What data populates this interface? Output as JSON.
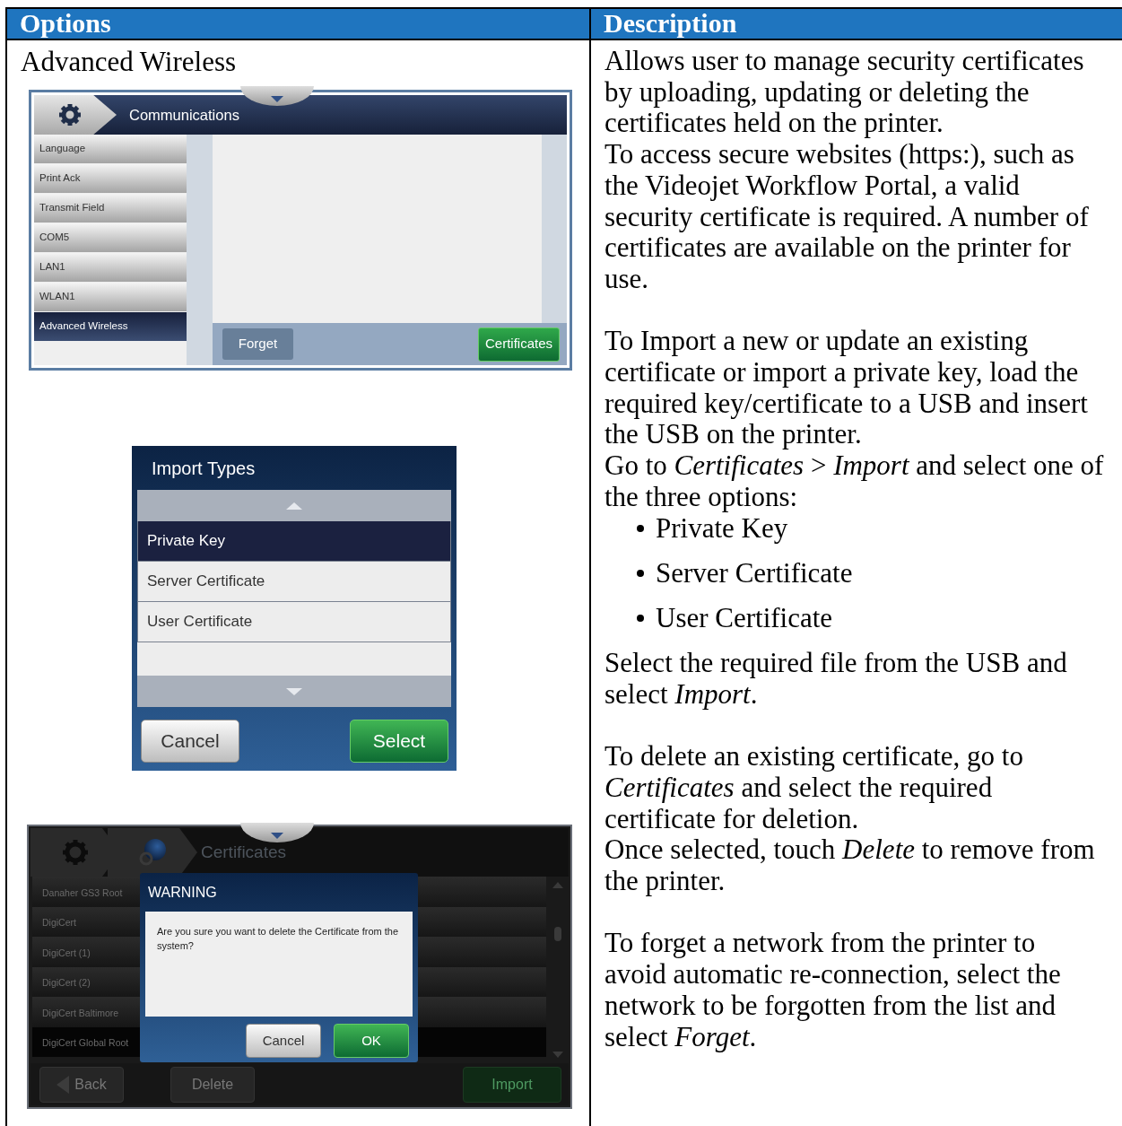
{
  "table": {
    "columns": [
      "Options",
      "Description"
    ]
  },
  "option": {
    "title": "Advanced Wireless"
  },
  "communications_screen": {
    "title": "Communications",
    "menu": [
      {
        "label": "Language",
        "selected": false
      },
      {
        "label": "Print Ack",
        "selected": false
      },
      {
        "label": "Transmit Field",
        "selected": false
      },
      {
        "label": "COM5",
        "selected": false
      },
      {
        "label": "LAN1",
        "selected": false
      },
      {
        "label": "WLAN1",
        "selected": false
      },
      {
        "label": "Advanced Wireless",
        "selected": true
      }
    ],
    "buttons": [
      {
        "label": "Forget",
        "kind": "secondary"
      },
      {
        "label": "Certificates",
        "kind": "primary"
      }
    ]
  },
  "import_types_dialog": {
    "title": "Import Types",
    "options": [
      {
        "label": "Private Key",
        "selected": true
      },
      {
        "label": "Server Certificate",
        "selected": false
      },
      {
        "label": "User Certificate",
        "selected": false
      }
    ],
    "buttons": [
      {
        "label": "Cancel",
        "kind": "secondary"
      },
      {
        "label": "Select",
        "kind": "primary"
      }
    ]
  },
  "certificates_screen": {
    "title": "Certificates",
    "items": [
      {
        "label": "Danaher GS3 Root",
        "selected": false
      },
      {
        "label": "DigiCert",
        "selected": false
      },
      {
        "label": "DigiCert (1)",
        "selected": false
      },
      {
        "label": "DigiCert (2)",
        "selected": false
      },
      {
        "label": "DigiCert Baltimore",
        "selected": false
      },
      {
        "label": "DigiCert Global Root",
        "selected": true
      }
    ],
    "buttons": [
      {
        "label": "Back",
        "kind": "back"
      },
      {
        "label": "Delete",
        "kind": "secondary"
      },
      {
        "label": "Import",
        "kind": "primary"
      }
    ],
    "dialog": {
      "title": "WARNING",
      "message": "Are you sure you want to delete the Certificate from the system?",
      "buttons": [
        {
          "label": "Cancel",
          "kind": "secondary"
        },
        {
          "label": "OK",
          "kind": "primary"
        }
      ]
    }
  },
  "description": [
    {
      "blocks": [
        {
          "kind": "para",
          "lines": [
            "Allows user to manage security certificates",
            "by uploading, updating or deleting the",
            "certificates held on the printer."
          ]
        },
        {
          "kind": "para",
          "lines": [
            "To access secure websites (https:), such as",
            "the Videojet Workflow Portal, a valid",
            "security certificate is required. A number of",
            "certificates are available on the printer for",
            "use."
          ]
        }
      ]
    },
    {
      "blocks": [
        {
          "kind": "para",
          "lines": [
            "To Import a new or update an existing",
            "certificate or import a private key, load the",
            "required key/certificate to a USB and insert",
            "the USB on the printer."
          ]
        },
        {
          "kind": "para",
          "lines": [
            "Go to *Certificates* > *Import* and select one of",
            "the three options:"
          ]
        },
        {
          "kind": "bullets",
          "items": [
            "Private Key",
            "Server Certificate",
            "User Certificate"
          ]
        },
        {
          "kind": "para",
          "lines": [
            "Select the required file from the USB and",
            "select *Import*."
          ]
        }
      ]
    },
    {
      "blocks": [
        {
          "kind": "para",
          "lines": [
            "To delete an existing certificate, go to",
            "*Certificates* and select the required",
            "certificate for deletion."
          ]
        },
        {
          "kind": "para",
          "lines": [
            "Once selected, touch *Delete* to remove from",
            "the printer."
          ]
        }
      ]
    },
    {
      "blocks": [
        {
          "kind": "para",
          "lines": [
            "To forget a network from the printer to",
            "avoid automatic re-connection, select the",
            "network to be forgotten from the list and",
            "select *Forget*."
          ]
        }
      ]
    }
  ]
}
